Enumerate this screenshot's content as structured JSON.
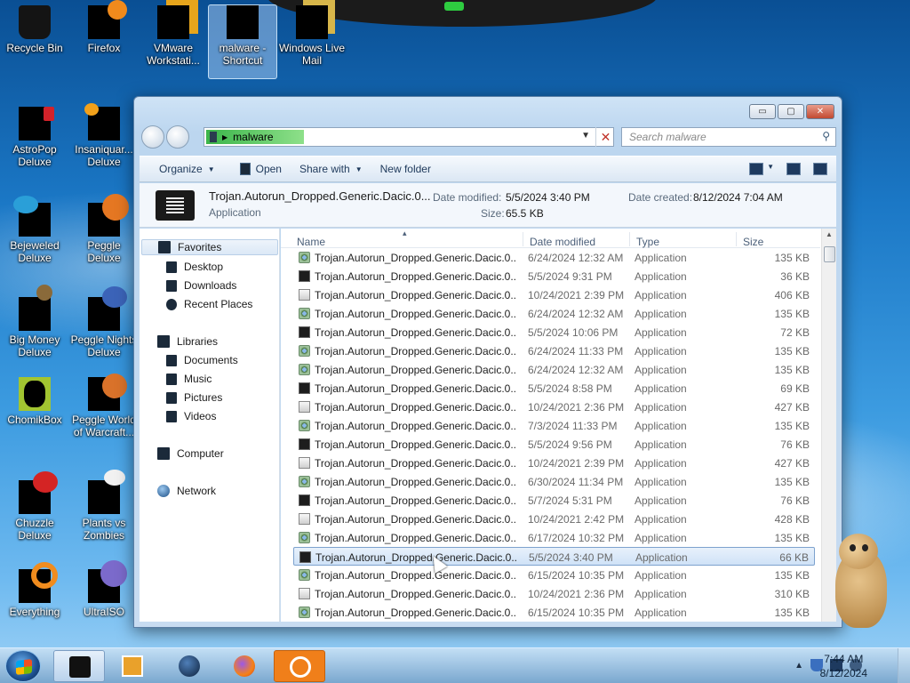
{
  "desktop": {
    "icons": [
      {
        "label": "Recycle Bin"
      },
      {
        "label": "Firefox"
      },
      {
        "label": "VMware Workstati..."
      },
      {
        "label": "malware - Shortcut"
      },
      {
        "label": "Windows Live Mail"
      },
      {
        "label": "AstroPop Deluxe"
      },
      {
        "label": "Insaniquar... Deluxe"
      },
      {
        "label": "Bejeweled Deluxe"
      },
      {
        "label": "Peggle Deluxe"
      },
      {
        "label": "Big Money Deluxe"
      },
      {
        "label": "Peggle Nights Deluxe"
      },
      {
        "label": "ChomikBox"
      },
      {
        "label": "Peggle World of Warcraft..."
      },
      {
        "label": "Chuzzle Deluxe"
      },
      {
        "label": "Plants vs Zombies"
      },
      {
        "label": "Everything"
      },
      {
        "label": "UltraISO"
      }
    ]
  },
  "window": {
    "controls": {
      "minimize": "▭",
      "maximize": "▢",
      "close": "✕"
    },
    "address": {
      "path": "malware"
    },
    "search": {
      "placeholder": "Search malware"
    },
    "toolbar": {
      "organize": "Organize",
      "open": "Open",
      "share_with": "Share with",
      "new_folder": "New folder"
    },
    "details": {
      "name": "Trojan.Autorun_Dropped.Generic.Dacic.0...",
      "type": "Application",
      "date_modified_label": "Date modified:",
      "date_modified": "5/5/2024 3:40 PM",
      "date_created_label": "Date created:",
      "date_created": "8/12/2024 7:04 AM",
      "size_label": "Size:",
      "size": "65.5 KB"
    },
    "nav": {
      "favorites": "Favorites",
      "desktop": "Desktop",
      "downloads": "Downloads",
      "recent": "Recent Places",
      "libraries": "Libraries",
      "documents": "Documents",
      "music": "Music",
      "pictures": "Pictures",
      "videos": "Videos",
      "computer": "Computer",
      "network": "Network"
    },
    "columns": {
      "name": "Name",
      "date": "Date modified",
      "type": "Type",
      "size": "Size"
    },
    "files": [
      {
        "name": "Trojan.Autorun_Dropped.Generic.Dacic.0...",
        "date": "6/24/2024 12:32 AM",
        "type": "Application",
        "size": "135 KB",
        "icon": "gear"
      },
      {
        "name": "Trojan.Autorun_Dropped.Generic.Dacic.0...",
        "date": "5/5/2024 9:31 PM",
        "type": "Application",
        "size": "36 KB",
        "icon": "black"
      },
      {
        "name": "Trojan.Autorun_Dropped.Generic.Dacic.0...",
        "date": "10/24/2021 2:39 PM",
        "type": "Application",
        "size": "406 KB",
        "icon": "doc"
      },
      {
        "name": "Trojan.Autorun_Dropped.Generic.Dacic.0...",
        "date": "6/24/2024 12:32 AM",
        "type": "Application",
        "size": "135 KB",
        "icon": "gear"
      },
      {
        "name": "Trojan.Autorun_Dropped.Generic.Dacic.0...",
        "date": "5/5/2024 10:06 PM",
        "type": "Application",
        "size": "72 KB",
        "icon": "black"
      },
      {
        "name": "Trojan.Autorun_Dropped.Generic.Dacic.0...",
        "date": "6/24/2024 11:33 PM",
        "type": "Application",
        "size": "135 KB",
        "icon": "gear"
      },
      {
        "name": "Trojan.Autorun_Dropped.Generic.Dacic.0...",
        "date": "6/24/2024 12:32 AM",
        "type": "Application",
        "size": "135 KB",
        "icon": "gear"
      },
      {
        "name": "Trojan.Autorun_Dropped.Generic.Dacic.0...",
        "date": "5/5/2024 8:58 PM",
        "type": "Application",
        "size": "69 KB",
        "icon": "black"
      },
      {
        "name": "Trojan.Autorun_Dropped.Generic.Dacic.0...",
        "date": "10/24/2021 2:36 PM",
        "type": "Application",
        "size": "427 KB",
        "icon": "doc"
      },
      {
        "name": "Trojan.Autorun_Dropped.Generic.Dacic.0...",
        "date": "7/3/2024 11:33 PM",
        "type": "Application",
        "size": "135 KB",
        "icon": "gear"
      },
      {
        "name": "Trojan.Autorun_Dropped.Generic.Dacic.0...",
        "date": "5/5/2024 9:56 PM",
        "type": "Application",
        "size": "76 KB",
        "icon": "black"
      },
      {
        "name": "Trojan.Autorun_Dropped.Generic.Dacic.0...",
        "date": "10/24/2021 2:39 PM",
        "type": "Application",
        "size": "427 KB",
        "icon": "doc"
      },
      {
        "name": "Trojan.Autorun_Dropped.Generic.Dacic.0...",
        "date": "6/30/2024 11:34 PM",
        "type": "Application",
        "size": "135 KB",
        "icon": "gear"
      },
      {
        "name": "Trojan.Autorun_Dropped.Generic.Dacic.0...",
        "date": "5/7/2024 5:31 PM",
        "type": "Application",
        "size": "76 KB",
        "icon": "black"
      },
      {
        "name": "Trojan.Autorun_Dropped.Generic.Dacic.0...",
        "date": "10/24/2021 2:42 PM",
        "type": "Application",
        "size": "428 KB",
        "icon": "doc"
      },
      {
        "name": "Trojan.Autorun_Dropped.Generic.Dacic.0...",
        "date": "6/17/2024 10:32 PM",
        "type": "Application",
        "size": "135 KB",
        "icon": "gear"
      },
      {
        "name": "Trojan.Autorun_Dropped.Generic.Dacic.0...",
        "date": "5/5/2024 3:40 PM",
        "type": "Application",
        "size": "66 KB",
        "icon": "black",
        "selected": true
      },
      {
        "name": "Trojan.Autorun_Dropped.Generic.Dacic.0...",
        "date": "6/15/2024 10:35 PM",
        "type": "Application",
        "size": "135 KB",
        "icon": "gear"
      },
      {
        "name": "Trojan.Autorun_Dropped.Generic.Dacic.0...",
        "date": "10/24/2021 2:36 PM",
        "type": "Application",
        "size": "310 KB",
        "icon": "doc"
      },
      {
        "name": "Trojan.Autorun_Dropped.Generic.Dacic.0...",
        "date": "6/15/2024 10:35 PM",
        "type": "Application",
        "size": "135 KB",
        "icon": "gear"
      }
    ]
  },
  "taskbar": {
    "clock": {
      "time": "7:44 AM",
      "date": "8/12/2024"
    }
  },
  "colors": {
    "selection": "#cfe2f7",
    "address_segment": "#3bb54a"
  }
}
